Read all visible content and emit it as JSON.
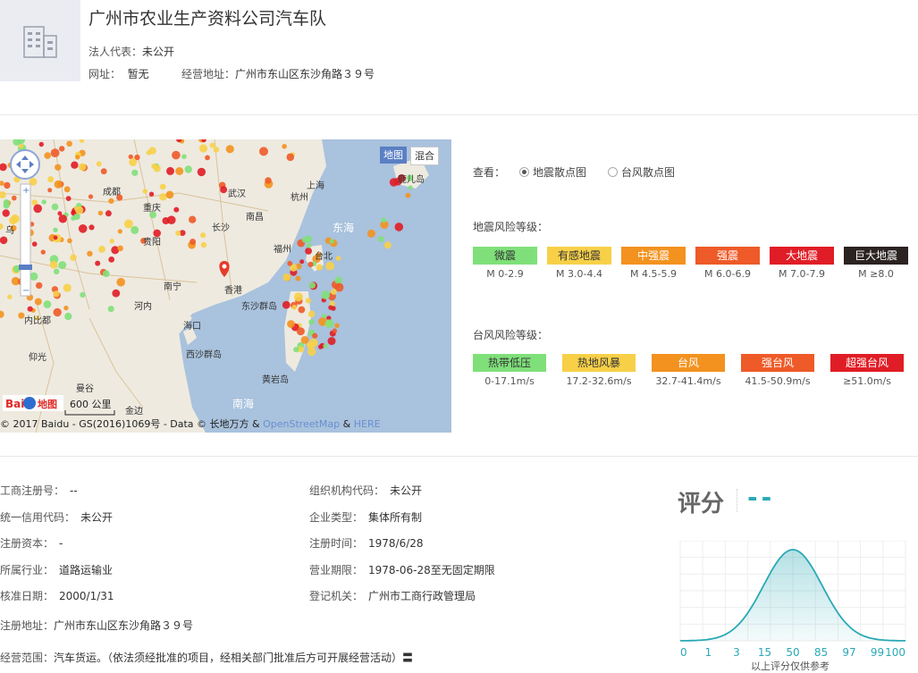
{
  "company": {
    "name": "广州市农业生产资料公司汽车队",
    "legal_rep_label": "法人代表：",
    "legal_rep_value": "未公开",
    "website_label": "网址：",
    "website_value": "暂无",
    "address_label": "经营地址：",
    "address_value": "广州市东山区东沙角路３９号"
  },
  "map": {
    "btn_map": "地图",
    "btn_hybrid": "混合",
    "scale_text": "600 公里",
    "baidu_logo": "Baidu地图",
    "copyright_a": "© 2017 Baidu - GS(2016)1069号 - Data © 长地万方 & ",
    "copyright_osm": "OpenStreetMap",
    "copyright_amp": " & ",
    "copyright_here": "HERE",
    "cities": [
      "武汉",
      "杭州",
      "上海",
      "重庆",
      "成都",
      "南昌",
      "贵阳",
      "长沙",
      "福州",
      "台北",
      "南宁",
      "香港",
      "河内",
      "海口",
      "内比都",
      "仰光",
      "曼谷",
      "金边",
      "东海",
      "南海",
      "东沙群岛",
      "西沙群岛",
      "黄岩岛",
      "鹿儿岛",
      "乌"
    ]
  },
  "legend": {
    "view_label": "查看：",
    "opt_quake": "地震散点图",
    "opt_typhoon": "台风散点图",
    "quake_title": "地震风险等级：",
    "quake_levels": [
      {
        "name": "微震",
        "range": "M 0-2.9",
        "bg": "#7fe07a",
        "fg": "#333"
      },
      {
        "name": "有感地震",
        "range": "M 3.0-4.4",
        "bg": "#f7d048",
        "fg": "#333"
      },
      {
        "name": "中强震",
        "range": "M 4.5-5.9",
        "bg": "#f3921e",
        "fg": "#fff"
      },
      {
        "name": "强震",
        "range": "M 6.0-6.9",
        "bg": "#ee5a28",
        "fg": "#fff"
      },
      {
        "name": "大地震",
        "range": "M 7.0-7.9",
        "bg": "#e01d26",
        "fg": "#fff"
      },
      {
        "name": "巨大地震",
        "range": "M ≥8.0",
        "bg": "#2b2222",
        "fg": "#fff"
      }
    ],
    "typhoon_title": "台风风险等级：",
    "typhoon_levels": [
      {
        "name": "热带低压",
        "range": "0-17.1m/s",
        "bg": "#7fe07a",
        "fg": "#333"
      },
      {
        "name": "热地风暴",
        "range": "17.2-32.6m/s",
        "bg": "#f7d048",
        "fg": "#333"
      },
      {
        "name": "台风",
        "range": "32.7-41.4m/s",
        "bg": "#f3921e",
        "fg": "#fff"
      },
      {
        "name": "强台风",
        "range": "41.5-50.9m/s",
        "bg": "#ee5a28",
        "fg": "#fff"
      },
      {
        "name": "超强台风",
        "range": "≥51.0m/s",
        "bg": "#e01d26",
        "fg": "#fff"
      }
    ]
  },
  "info": {
    "reg_no_label": "工商注册号：",
    "reg_no": "--",
    "org_code_label": "组织机构代码：",
    "org_code": "未公开",
    "credit_label": "统一信用代码：",
    "credit": "未公开",
    "type_label": "企业类型：",
    "type": "集体所有制",
    "capital_label": "注册资本：",
    "capital": "-",
    "reg_time_label": "注册时间：",
    "reg_time": "1978/6/28",
    "industry_label": "所属行业：",
    "industry": "道路运输业",
    "term_label": "营业期限：",
    "term": "1978-06-28至无固定期限",
    "approve_label": "核准日期：",
    "approve": "2000/1/31",
    "authority_label": "登记机关：",
    "authority": "广州市工商行政管理局",
    "reg_addr_label": "注册地址：",
    "reg_addr": "广州市东山区东沙角路３９号",
    "scope_label": "经营范围：",
    "scope": "汽车货运。（依法须经批准的项目，经相关部门批准后方可开展经营活动）〓"
  },
  "score": {
    "label": "评分",
    "value": "--",
    "ticks": [
      "0",
      "1",
      "3",
      "15",
      "50",
      "85",
      "97",
      "99",
      "100"
    ],
    "note": "以上评分仅供参考",
    "color": "#2aa9b5"
  }
}
